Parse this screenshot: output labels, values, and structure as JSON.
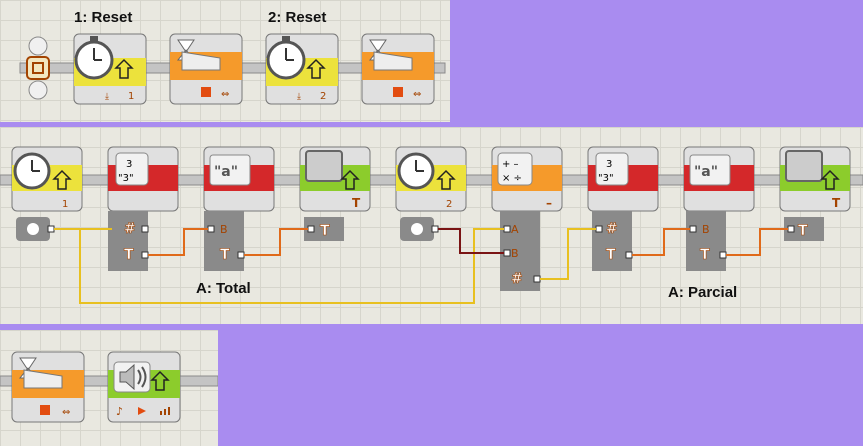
{
  "labels": {
    "reset_1": "1: Reset",
    "reset_2": "2: Reset",
    "total": "A: Total",
    "parcial": "A: Parcial"
  },
  "plugs": {
    "number": "#",
    "text": "T",
    "input_a": "A",
    "input_b": "B"
  },
  "blocks": {
    "timer_1_port": "1",
    "timer_2_port": "2",
    "number_to_text_icon_top": "3",
    "number_to_text_icon_bottom": "\"3\"",
    "text_icon": "\"a\"",
    "math_minus": "–"
  },
  "colors": {
    "sensor_yellow": "#ece23c",
    "flow_orange": "#f59a2b",
    "data_red": "#d4282a",
    "action_green": "#8ccc2c",
    "wire_text": "#e06a1a",
    "wire_number": "#e8c020",
    "wire_logic": "#7a1414",
    "background": "#a98cf0"
  },
  "icons": [
    "stopwatch-icon",
    "hourglass-icon",
    "display-icon",
    "speaker-icon",
    "calculator-icon",
    "stop-square-icon",
    "reset-arrow-icon",
    "play-icon"
  ]
}
